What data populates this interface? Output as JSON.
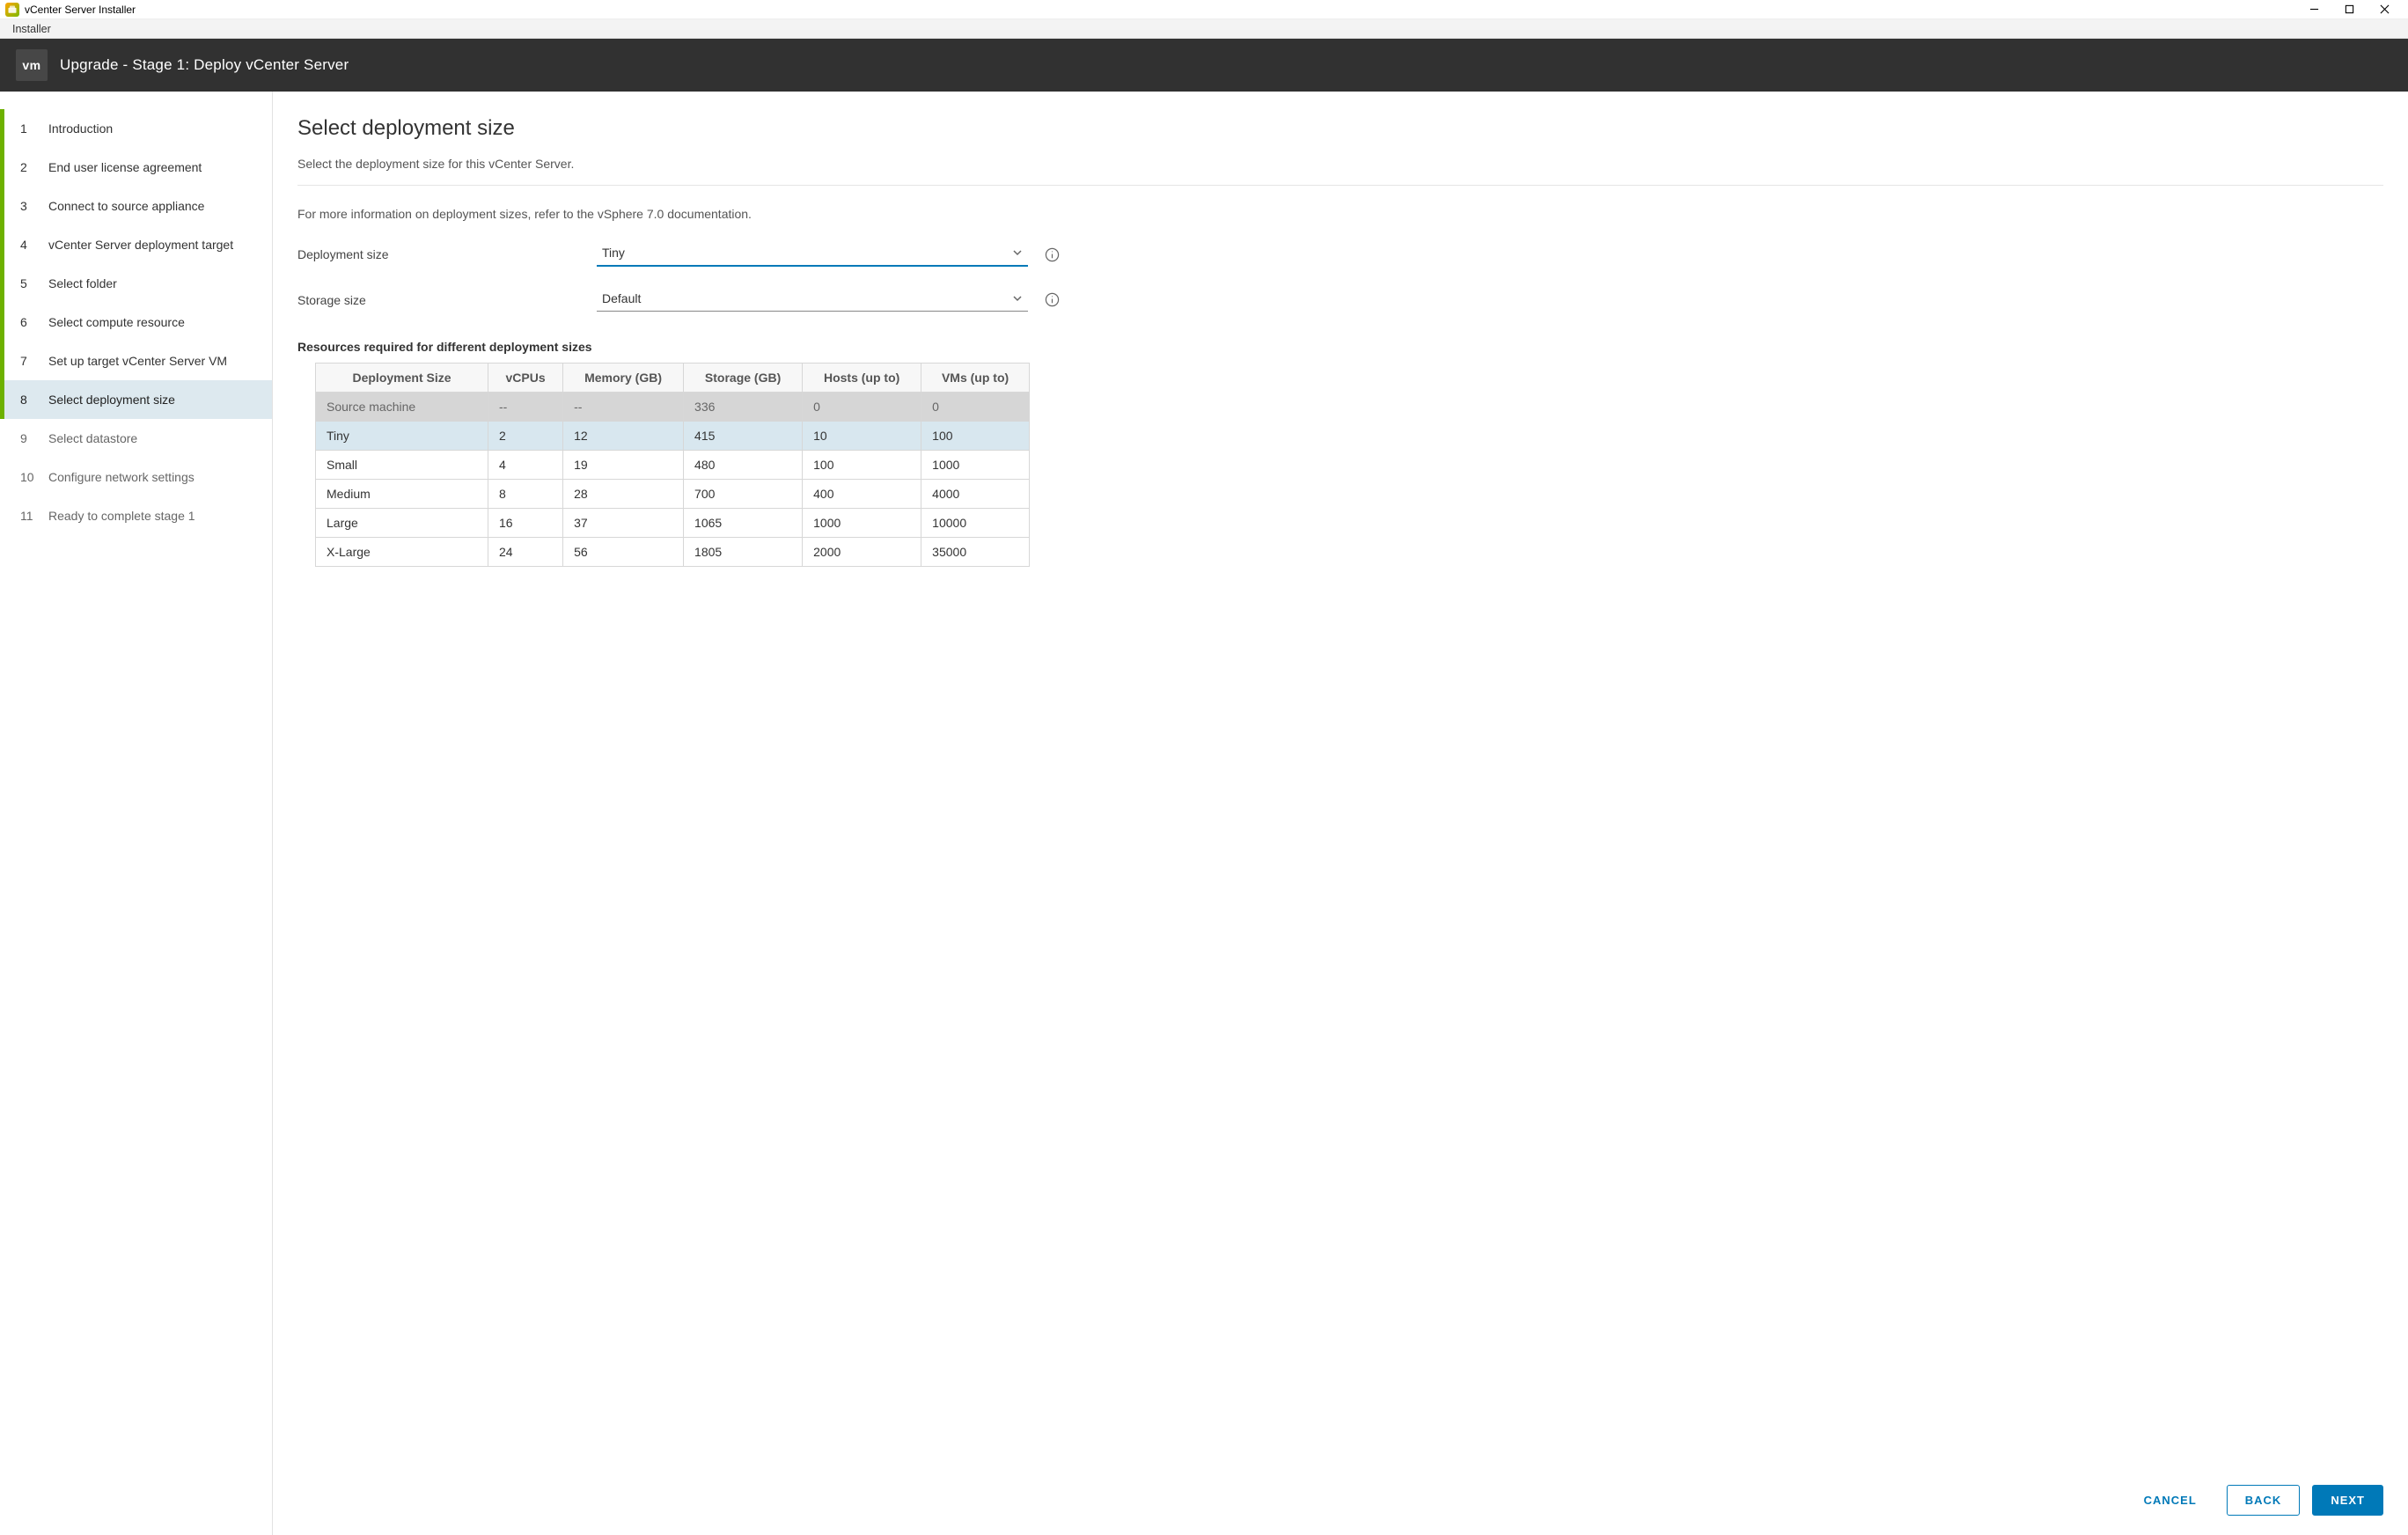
{
  "window": {
    "title": "vCenter Server Installer",
    "menu": {
      "installer": "Installer"
    }
  },
  "header": {
    "badge": "vm",
    "title": "Upgrade - Stage 1: Deploy vCenter Server"
  },
  "steps": [
    {
      "num": "1",
      "label": "Introduction",
      "state": "completed"
    },
    {
      "num": "2",
      "label": "End user license agreement",
      "state": "completed"
    },
    {
      "num": "3",
      "label": "Connect to source appliance",
      "state": "completed"
    },
    {
      "num": "4",
      "label": "vCenter Server deployment target",
      "state": "completed"
    },
    {
      "num": "5",
      "label": "Select folder",
      "state": "completed"
    },
    {
      "num": "6",
      "label": "Select compute resource",
      "state": "completed"
    },
    {
      "num": "7",
      "label": "Set up target vCenter Server VM",
      "state": "completed"
    },
    {
      "num": "8",
      "label": "Select deployment size",
      "state": "active"
    },
    {
      "num": "9",
      "label": "Select datastore",
      "state": "pending"
    },
    {
      "num": "10",
      "label": "Configure network settings",
      "state": "pending"
    },
    {
      "num": "11",
      "label": "Ready to complete stage 1",
      "state": "pending"
    }
  ],
  "page": {
    "title": "Select deployment size",
    "subtitle": "Select the deployment size for this vCenter Server.",
    "help": "For more information on deployment sizes, refer to the vSphere 7.0 documentation.",
    "form": {
      "deployment_label": "Deployment size",
      "deployment_value": "Tiny",
      "storage_label": "Storage size",
      "storage_value": "Default"
    },
    "resources_title": "Resources required for different deployment sizes",
    "table": {
      "headers": [
        "Deployment Size",
        "vCPUs",
        "Memory (GB)",
        "Storage (GB)",
        "Hosts (up to)",
        "VMs (up to)"
      ],
      "rows": [
        {
          "kind": "source",
          "cells": [
            "Source machine",
            "--",
            "--",
            "336",
            "0",
            "0"
          ]
        },
        {
          "kind": "selected",
          "cells": [
            "Tiny",
            "2",
            "12",
            "415",
            "10",
            "100"
          ]
        },
        {
          "kind": "normal",
          "cells": [
            "Small",
            "4",
            "19",
            "480",
            "100",
            "1000"
          ]
        },
        {
          "kind": "normal",
          "cells": [
            "Medium",
            "8",
            "28",
            "700",
            "400",
            "4000"
          ]
        },
        {
          "kind": "normal",
          "cells": [
            "Large",
            "16",
            "37",
            "1065",
            "1000",
            "10000"
          ]
        },
        {
          "kind": "normal",
          "cells": [
            "X-Large",
            "24",
            "56",
            "1805",
            "2000",
            "35000"
          ]
        }
      ]
    }
  },
  "footer": {
    "cancel": "CANCEL",
    "back": "BACK",
    "next": "NEXT"
  }
}
